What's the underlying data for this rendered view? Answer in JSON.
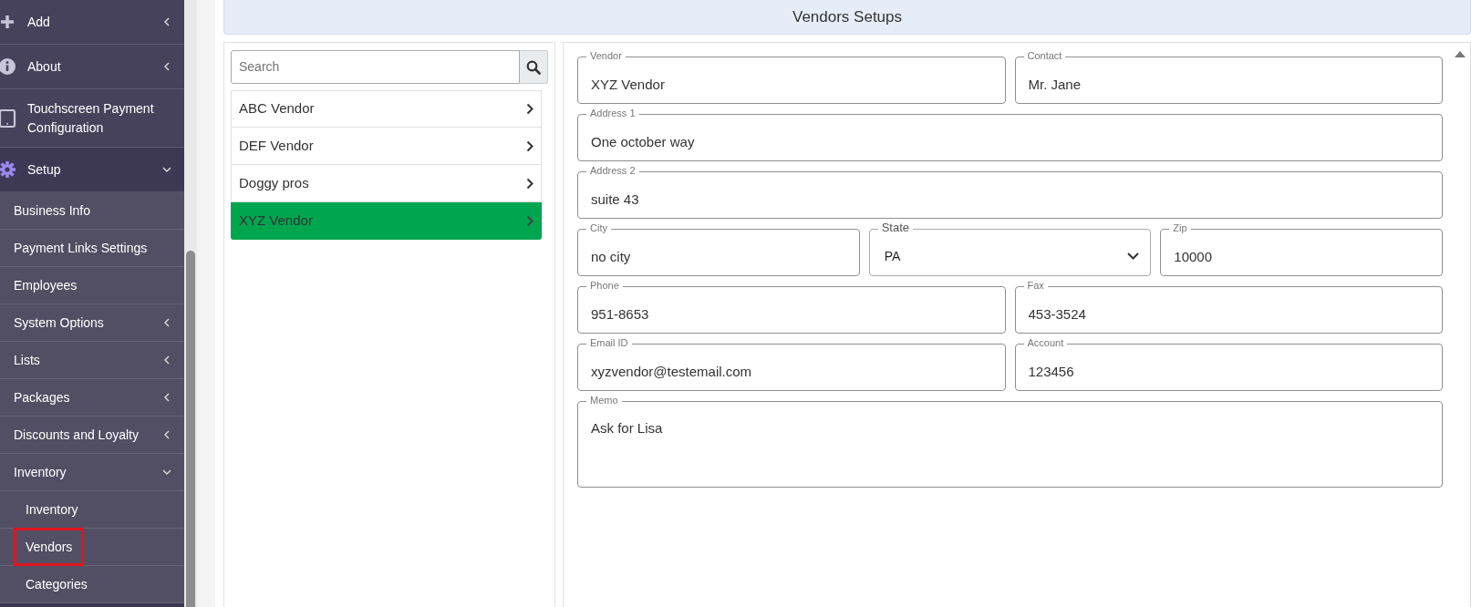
{
  "sidebar": {
    "items": [
      {
        "label": "Add",
        "expanded": false
      },
      {
        "label": "About",
        "expanded": false
      },
      {
        "label": "Touchscreen Payment Configuration"
      },
      {
        "label": "Setup",
        "expanded": true,
        "children": [
          {
            "label": "Business Info"
          },
          {
            "label": "Payment Links Settings"
          },
          {
            "label": "Employees"
          },
          {
            "label": "System Options",
            "expanded": false
          },
          {
            "label": "Lists",
            "expanded": false
          },
          {
            "label": "Packages",
            "expanded": false
          },
          {
            "label": "Discounts and Loyalty",
            "expanded": false
          },
          {
            "label": "Inventory",
            "expanded": true,
            "children": [
              {
                "label": "Inventory",
                "selected": false
              },
              {
                "label": "Vendors",
                "selected": true
              },
              {
                "label": "Categories",
                "selected": false
              }
            ]
          }
        ]
      }
    ]
  },
  "page_title": "Vendors Setups",
  "vendor_list": {
    "search": {
      "placeholder": "Search"
    },
    "items": [
      {
        "label": "ABC Vendor",
        "selected": false
      },
      {
        "label": "DEF Vendor",
        "selected": false
      },
      {
        "label": "Doggy pros",
        "selected": false
      },
      {
        "label": "XYZ Vendor",
        "selected": true
      }
    ]
  },
  "form": {
    "rows": [
      [
        {
          "kind": "text",
          "label": "Vendor",
          "value": "XYZ Vendor"
        },
        {
          "kind": "text",
          "label": "Contact",
          "value": "Mr. Jane"
        }
      ],
      [
        {
          "kind": "text",
          "label": "Address 1",
          "value": "One october way"
        }
      ],
      [
        {
          "kind": "text",
          "label": "Address 2",
          "value": "suite 43"
        }
      ],
      [
        {
          "kind": "text",
          "label": "City",
          "value": "no city"
        },
        {
          "kind": "select",
          "label": "State",
          "value": "PA"
        },
        {
          "kind": "text",
          "label": "Zip",
          "value": "10000"
        }
      ],
      [
        {
          "kind": "text",
          "label": "Phone",
          "value": "951-8653"
        },
        {
          "kind": "text",
          "label": "Fax",
          "value": "453-3524"
        }
      ],
      [
        {
          "kind": "text",
          "label": "Email ID",
          "value": "xyzvendor@testemail.com"
        },
        {
          "kind": "text",
          "label": "Account",
          "value": "123456"
        }
      ],
      [
        {
          "kind": "textarea",
          "label": "Memo",
          "value": "Ask for Lisa"
        }
      ]
    ]
  }
}
